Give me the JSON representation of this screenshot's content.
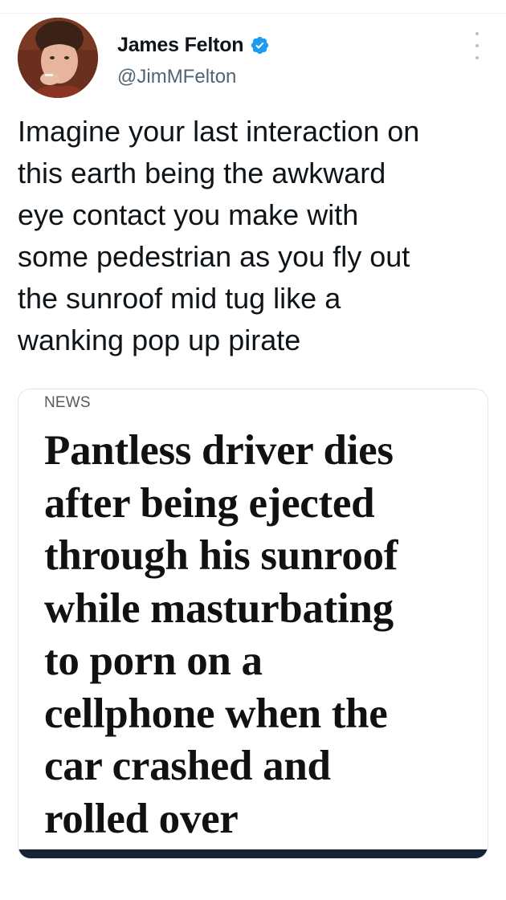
{
  "author": {
    "name": "James Felton",
    "handle": "@JimMFelton",
    "verified": true
  },
  "tweet": {
    "text": "Imagine your last interaction on\nthis earth being the awkward\neye contact you make with\nsome pedestrian as you fly out\nthe sunroof mid tug like a\nwanking pop up pirate"
  },
  "media": {
    "section_label": "NEWS",
    "headline": "Pantless driver dies\nafter being ejected\nthrough his sunroof\nwhile masturbating\nto porn on a\ncellphone when the\ncar crashed and\nrolled over"
  },
  "icons": {
    "verified": "verified-badge-icon",
    "more": "more-options-icon"
  },
  "colors": {
    "verified_blue": "#1d9bf0",
    "handle_gray": "#536471",
    "text": "#0f1419",
    "media_bar": "#142336"
  }
}
